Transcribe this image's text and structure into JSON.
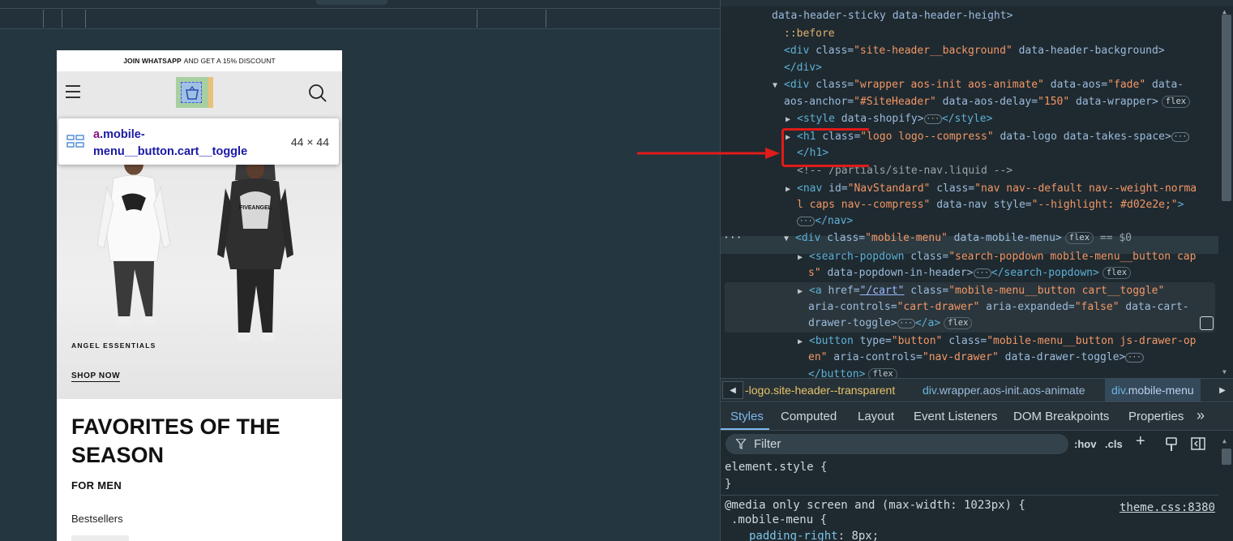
{
  "viewport": {
    "announcement_bold": "JOIN WHATSAPP",
    "announcement_rest": "AND GET A 15% DISCOUNT",
    "hero_label": "ANGEL ESSENTIALS",
    "hero_cta": "SHOP NOW",
    "section_title": "FAVORITES OF THE SEASON",
    "section_subtitle": "FOR MEN",
    "section_tab": "Bestsellers",
    "tooltip": {
      "tag": "a",
      "class_name": ".mobile-menu__button.cart__toggle",
      "size": "44 × 44"
    },
    "hoodie_print": "FIVEANGEL"
  },
  "elements_panel": {
    "lines": [
      {
        "t": "data-header-sticky data-header-height>"
      },
      {
        "t": "::before"
      },
      {
        "t1": "<div ",
        "a": "class=",
        "v": "\"site-header__background\"",
        "t2": " data-header-background>"
      },
      {
        "t": "</div>"
      },
      {
        "t1": "<div ",
        "a": "class=",
        "v": "\"wrapper aos-init aos-animate\"",
        "t2": " data-aos=",
        "v2": "\"fade\"",
        "t3": " data-"
      },
      {
        "t1": "aos-anchor=",
        "v": "\"#SiteHeader\"",
        "t2": " data-aos-delay=",
        "v2": "\"150\"",
        "t3": " data-wrapper>",
        "badge": "flex"
      },
      {
        "t1": "<style ",
        "a": "data-shopify>",
        "t2": "</style>"
      },
      {
        "t1": "<h1 ",
        "a": "class=",
        "v": "\"logo logo--compress\"",
        "t2": " data-logo data-takes-space>"
      },
      {
        "t": "</h1>"
      },
      {
        "t": "<!-- /partials/site-nav.liquid -->"
      },
      {
        "t1": "<nav ",
        "a": "id=",
        "v": "\"NavStandard\"",
        "t2": " class=",
        "v2": "\"nav nav--default nav--weight-norma"
      },
      {
        "v": "l caps nav--compress\"",
        "t2": " data-nav style=",
        "v2": "\"--highlight: #d02e2e;\"",
        "t3": ">"
      },
      {
        "t": "</nav>"
      },
      {
        "t1": "<div ",
        "a": "class=",
        "v": "\"mobile-menu\"",
        "t2": " data-mobile-menu>",
        "badge": "flex",
        "tail": "== $0"
      },
      {
        "t1": "<search-popdown ",
        "a": "class=",
        "v": "\"search-popdown mobile-menu__button cap"
      },
      {
        "v": "s\"",
        "t2": " data-popdown-in-header>",
        "t3": "</search-popdown>",
        "badge": "flex"
      },
      {
        "t1": "<a ",
        "a": "href=",
        "link": "\"/cart\"",
        "t2": " class=",
        "v": "\"mobile-menu__button cart__toggle\""
      },
      {
        "t1": "aria-controls=",
        "v": "\"cart-drawer\"",
        "t2": " aria-expanded=",
        "v2": "\"false\"",
        "t3": " data-cart-"
      },
      {
        "t1": "drawer-toggle>",
        "t3": "</a>",
        "badge": "flex"
      },
      {
        "t1": "<button ",
        "a": "type=",
        "v": "\"button\"",
        "t2": " class=",
        "v2": "\"mobile-menu__button js-drawer-op"
      },
      {
        "v": "en\"",
        "t2": " aria-controls=",
        "v2": "\"nav-drawer\"",
        "t3": " data-drawer-toggle>"
      },
      {
        "t": "</button>",
        "badge": "flex"
      }
    ]
  },
  "breadcrumbs": [
    {
      "tag": "",
      "cls": "-logo.site-header--transparent"
    },
    {
      "tag": "div",
      "cls": ".wrapper.aos-init.aos-animate"
    },
    {
      "tag": "div",
      "cls": ".mobile-menu"
    }
  ],
  "tabs": [
    "Styles",
    "Computed",
    "Layout",
    "Event Listeners",
    "DOM Breakpoints",
    "Properties"
  ],
  "tabs_more": "»",
  "filter": {
    "placeholder": "Filter",
    "hov": ":hov",
    "cls": ".cls"
  },
  "styles": {
    "element_style": "element.style {",
    "close_brace": "}",
    "media": "@media only screen and (max-width: 1023px) {",
    "selector": ".mobile-menu {",
    "source": "theme.css:8380",
    "prop": "padding-right",
    "prop_value": "8px;"
  }
}
